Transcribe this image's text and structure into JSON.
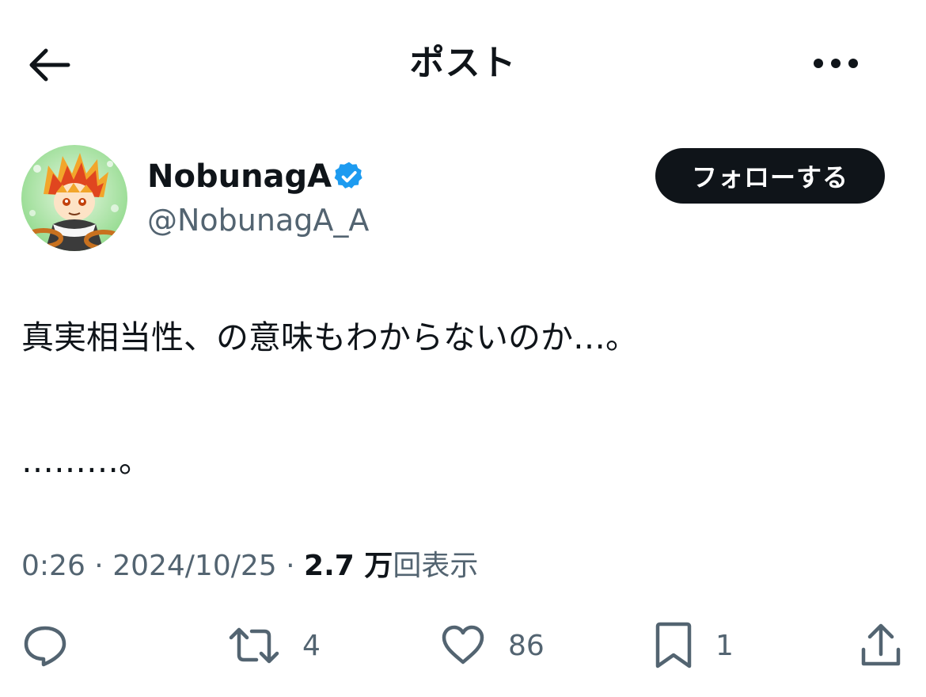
{
  "header": {
    "title": "ポスト",
    "back_icon": "arrow-left-icon",
    "more_icon": "more-horizontal-icon"
  },
  "author": {
    "display_name": "NobunagA",
    "handle": "@NobunagA_A",
    "verified": true,
    "verified_color": "#1d9bf0"
  },
  "follow_button": {
    "label": "フォローする"
  },
  "post": {
    "line1": "真実相当性、の意味もわからないのか…。",
    "line2": "………。"
  },
  "meta": {
    "time": "0:26",
    "date": "2024/10/25",
    "views_count": "2.7 万",
    "views_label": "回表示",
    "separator": " · "
  },
  "actions": {
    "reply": {
      "icon": "reply-icon",
      "count": ""
    },
    "repost": {
      "icon": "repost-icon",
      "count": "4"
    },
    "like": {
      "icon": "heart-icon",
      "count": "86"
    },
    "bookmark": {
      "icon": "bookmark-icon",
      "count": "1"
    },
    "share": {
      "icon": "share-icon",
      "count": ""
    }
  },
  "colors": {
    "text": "#0f1419",
    "secondary": "#536471",
    "button_bg": "#0f1419",
    "button_text": "#ffffff"
  }
}
